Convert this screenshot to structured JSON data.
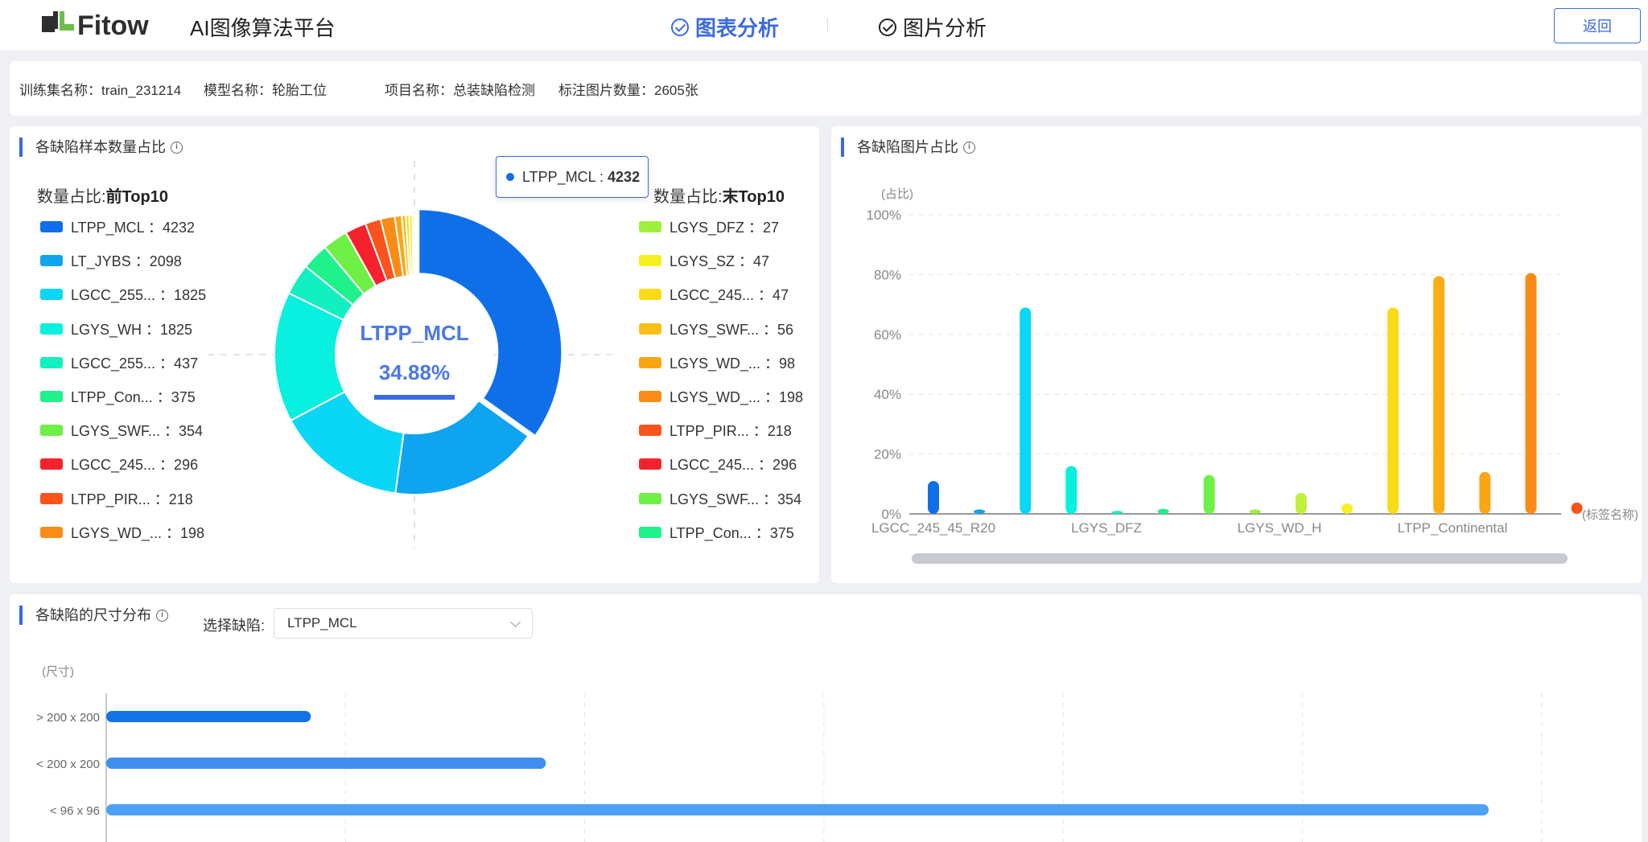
{
  "header": {
    "logo_text": "Fitow",
    "app_title": "AI图像算法平台",
    "tabs": [
      {
        "label": "图表分析",
        "active": true
      },
      {
        "label": "图片分析",
        "active": false
      }
    ],
    "back_label": "返回",
    "accent": "#3a6ae0"
  },
  "info": {
    "training_set": "训练集名称：train_231214",
    "model": "模型名称：轮胎工位",
    "project": "项目名称：总装缺陷检测",
    "image_count": "标注图片数量：2605张"
  },
  "pie_card": {
    "title": "各缺陷样本数量占比",
    "left_head_prefix": "数量占比:",
    "left_head_bold": "前Top10",
    "right_head_prefix": "数量占比:",
    "right_head_bold": "末Top10",
    "center_label": "LTPP_MCL",
    "center_value": "34.88%",
    "tooltip_name": "LTPP_MCL : ",
    "tooltip_value": "4232",
    "top10": [
      {
        "name": "LTPP_MCL",
        "value": "4232",
        "label": "LTPP_MCL ：4232",
        "color": "#0f6fe8"
      },
      {
        "name": "LT_JYBS",
        "value": "2098",
        "label": "LT_JYBS ：2098",
        "color": "#0ea4f0"
      },
      {
        "name": "LGCC_255...",
        "value": "1825",
        "label": "LGCC_255... ：1825",
        "color": "#0ad6f5"
      },
      {
        "name": "LGYS_WH",
        "value": "1825",
        "label": "LGYS_WH ：1825",
        "color": "#08f0e0"
      },
      {
        "name": "LGCC_255...",
        "value": "437",
        "label": "LGCC_255... ：437",
        "color": "#12efc0"
      },
      {
        "name": "LTPP_Con...",
        "value": "375",
        "label": "LTPP_Con... ：375",
        "color": "#1ff28a"
      },
      {
        "name": "LGYS_SWF...",
        "value": "354",
        "label": "LGYS_SWF... ：354",
        "color": "#6ef046"
      },
      {
        "name": "LGCC_245...",
        "value": "296",
        "label": "LGCC_245... ：296",
        "color": "#f5222d"
      },
      {
        "name": "LTPP_PIR...",
        "value": "218",
        "label": "LTPP_PIR... ：218",
        "color": "#fa541c"
      },
      {
        "name": "LGYS_WD_...",
        "value": "198",
        "label": "LGYS_WD_... ：198",
        "color": "#fa8c16"
      }
    ],
    "bottom10": [
      {
        "label": "LGYS_DFZ ：27",
        "color": "#a0ef3c"
      },
      {
        "label": "LGYS_SZ ：47",
        "color": "#f7f020"
      },
      {
        "label": "LGCC_245... ：47",
        "color": "#fadb14"
      },
      {
        "label": "LGYS_SWF... ：56",
        "color": "#fbbf18"
      },
      {
        "label": "LGYS_WD_... ：98",
        "color": "#faa514"
      },
      {
        "label": "LGYS_WD_... ：198",
        "color": "#fa8c16"
      },
      {
        "label": "LTPP_PIR... ：218",
        "color": "#fa541c"
      },
      {
        "label": "LGCC_245... ：296",
        "color": "#f5222d"
      },
      {
        "label": "LGYS_SWF... ：354",
        "color": "#6ef046"
      },
      {
        "label": "LTPP_Con... ：375",
        "color": "#1ff28a"
      }
    ]
  },
  "chart_data": [
    {
      "type": "pie",
      "title": "各缺陷样本数量占比",
      "labels": [
        "LTPP_MCL",
        "LT_JYBS",
        "LGCC_255...",
        "LGYS_WH",
        "LGCC_255...",
        "LTPP_Con...",
        "LGYS_SWF...",
        "LGCC_245...",
        "LTPP_PIR...",
        "LGYS_WD_...",
        "LGYS_WD_...",
        "LGYS_SWF...",
        "LGCC_245...",
        "LGYS_SZ",
        "LGYS_DFZ"
      ],
      "values": [
        4232,
        2098,
        1825,
        1825,
        437,
        375,
        354,
        296,
        218,
        198,
        98,
        56,
        47,
        47,
        27
      ],
      "colors": [
        "#0f6fe8",
        "#0ea4f0",
        "#0ad6f5",
        "#08f0e0",
        "#12efc0",
        "#1ff28a",
        "#6ef046",
        "#f5222d",
        "#fa541c",
        "#fa8c16",
        "#faa514",
        "#fbbf18",
        "#fadb14",
        "#f7f020",
        "#a0ef3c"
      ]
    },
    {
      "type": "bar",
      "title": "各缺陷图片占比",
      "ylabel": "(占比)",
      "xlabel": "(标签名称)",
      "yticks": [
        "100%",
        "80%",
        "60%",
        "40%",
        "20%",
        "0%"
      ],
      "ylim": [
        0,
        100
      ],
      "categories": [
        "LGCC_245_45_R20",
        "",
        "",
        "",
        "LGYS_DFZ",
        "",
        "",
        "",
        "LGYS_WD_H",
        "",
        "",
        "",
        "LTPP_Continental",
        "",
        "",
        ""
      ],
      "xtick_labels": [
        "LGCC_245_45_R20",
        "LGYS_DFZ",
        "LGYS_WD_H",
        "LTPP_Continental"
      ],
      "values": [
        11,
        1.5,
        69,
        16,
        1,
        1.7,
        13,
        1.5,
        7,
        3.5,
        69,
        79.5,
        14,
        80.5,
        3.8
      ],
      "colors": [
        "#0f6fe8",
        "#0ea4f0",
        "#0ad6f5",
        "#08f0e0",
        "#12efc0",
        "#1ff28a",
        "#6ef046",
        "#a0ef3c",
        "#bff03a",
        "#f7f020",
        "#fadb14",
        "#faad14",
        "#faa514",
        "#fa8c16",
        "#fa541c"
      ]
    },
    {
      "type": "bar",
      "orientation": "horizontal",
      "title": "各缺陷的尺寸分布",
      "ylabel": "(尺寸)",
      "categories": [
        "> 200 x 200",
        "< 200 x 200",
        "< 96 x 96"
      ],
      "values": [
        0.148,
        0.318,
        1.0
      ],
      "colors": [
        "#1273e6",
        "#3f8ff0",
        "#4ea0f5"
      ]
    }
  ],
  "size_card": {
    "title": "各缺陷的尺寸分布",
    "select_label": "选择缺陷:",
    "select_value": "LTPP_MCL",
    "ylabel": "(尺寸)",
    "categories": [
      "> 200 x 200",
      "< 200 x 200",
      "< 96 x 96"
    ]
  },
  "bar_card": {
    "title": "各缺陷图片占比",
    "ylabel": "(占比)",
    "xlabel": "(标签名称)"
  }
}
